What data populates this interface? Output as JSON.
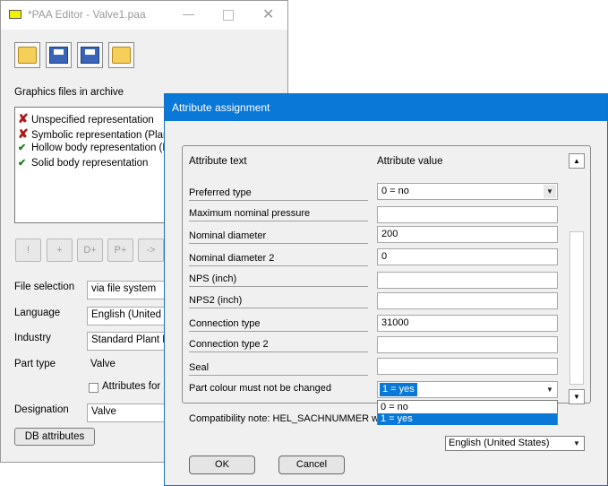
{
  "paa_window": {
    "title": "*PAA Editor - Valve1.paa",
    "graphics_label": "Graphics files in archive",
    "graphics_files": [
      {
        "status": "missing",
        "label": "Unspecified representation"
      },
      {
        "status": "missing",
        "label": "Symbolic representation (Plant"
      },
      {
        "status": "ok",
        "label": "Hollow body representation (Pl"
      },
      {
        "status": "ok",
        "label": "Solid body representation"
      }
    ],
    "side_buttons": [
      "!",
      "+",
      "D+",
      "P+",
      "->"
    ],
    "fields": {
      "file_selection_label": "File selection",
      "file_selection_value": "via file system",
      "language_label": "Language",
      "language_value": "English (United Sta",
      "industry_label": "Industry",
      "industry_value": "Standard Plant En",
      "part_type_label": "Part type",
      "part_type_value": "Valve",
      "attributes_checkbox_label": "Attributes for l",
      "designation_label": "Designation",
      "designation_value": "Valve"
    },
    "db_attributes_label": "DB attributes"
  },
  "dialog": {
    "title": "Attribute assignment",
    "col_attribute_text": "Attribute text",
    "col_attribute_value": "Attribute value",
    "rows": [
      {
        "label": "Preferred type",
        "value": "0 = no",
        "kind": "combo"
      },
      {
        "label": "Maximum nominal pressure",
        "value": "",
        "kind": "text"
      },
      {
        "label": "Nominal diameter",
        "value": "200",
        "kind": "text"
      },
      {
        "label": "Nominal diameter 2",
        "value": "0",
        "kind": "text"
      },
      {
        "label": "NPS (inch)",
        "value": "",
        "kind": "text"
      },
      {
        "label": "NPS2 (inch)",
        "value": "",
        "kind": "text"
      },
      {
        "label": "Connection type",
        "value": "31000",
        "kind": "text"
      },
      {
        "label": "Connection type 2",
        "value": "",
        "kind": "text"
      },
      {
        "label": "Seal",
        "value": "",
        "kind": "text"
      },
      {
        "label": "Part colour must not be changed",
        "value": "1 = yes",
        "kind": "combo"
      }
    ],
    "dropdown_options": [
      "0 = no",
      "1 = yes"
    ],
    "dropdown_selected": "1 = yes",
    "compat_note": "Compatibility note: HEL_SACHNUMMER will b",
    "language_select": "English (United States)",
    "ok_label": "OK",
    "cancel_label": "Cancel"
  },
  "colors": {
    "accent": "#0a78d7",
    "missing": "#b01818",
    "ok": "#1a7a1a"
  }
}
